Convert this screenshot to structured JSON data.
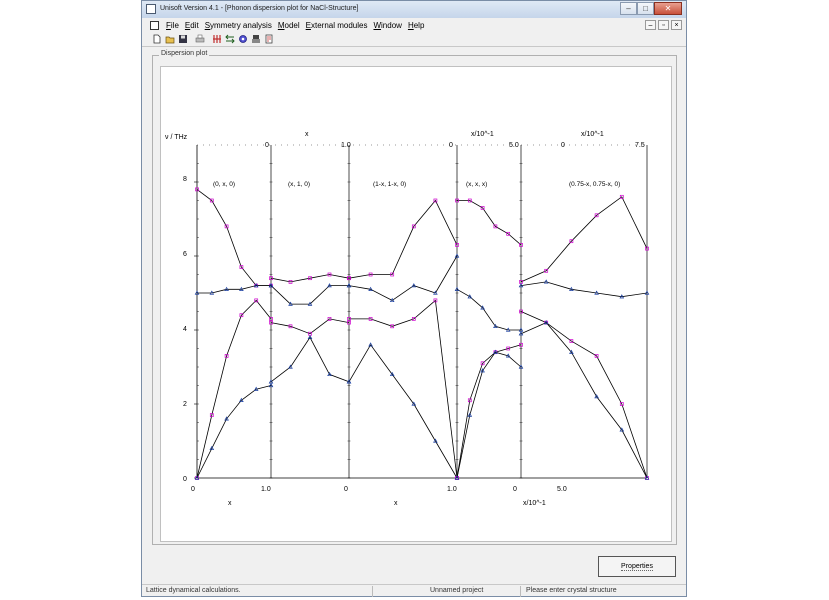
{
  "window": {
    "title": "Unisoft Version 4.1 - [Phonon dispersion plot for NaCl-Structure]"
  },
  "menu": {
    "items": [
      "File",
      "Edit",
      "Symmetry analysis",
      "Model",
      "External modules",
      "Window",
      "Help"
    ]
  },
  "toolbar": {
    "icons": [
      "new-file-icon",
      "open-folder-icon",
      "save-icon",
      "print-icon",
      "tool-a-icon",
      "tool-b-icon",
      "tool-c-icon",
      "tool-d-icon",
      "tool-e-icon"
    ]
  },
  "group": {
    "label": "Dispersion plot"
  },
  "plot": {
    "ylabel": "ν / THz",
    "y_ticks": [
      "0",
      "2",
      "4",
      "6",
      "8"
    ],
    "top_labels": {
      "p1": "x",
      "p1_start": "0",
      "p1_end": "1.0",
      "p3_start": "0",
      "p3_unit": "x/10^-1",
      "p3_end": "5.0",
      "p4_start": "0",
      "p4_unit": "x/10^-1",
      "p4_end": "7.5"
    },
    "bottom_labels": {
      "b0": "0",
      "b1": "1.0",
      "b2": "0",
      "b3": "1.0",
      "b4": "0",
      "b5": "5.0",
      "xl1": "x",
      "xl2": "x",
      "xl3": "x/10^-1"
    },
    "panel_labels": [
      "(0, x, 0)",
      "(x, 1, 0)",
      "(1-x, 1-x, 0)",
      "(x, x, x)",
      "(0.75-x, 0.75-x, 0)"
    ]
  },
  "chart_data": {
    "type": "line",
    "ylabel": "ν / THz",
    "ylim": [
      0,
      9
    ],
    "grid": false,
    "segments": [
      {
        "path": "(0, x, 0)",
        "x": [
          0,
          0.1,
          0.2,
          0.3,
          0.4,
          0.5
        ],
        "series": [
          {
            "values": [
              7.8,
              7.5,
              6.8,
              5.7,
              5.2,
              5.2
            ]
          },
          {
            "values": [
              5.0,
              5.0,
              5.1,
              5.1,
              5.2,
              5.2
            ]
          },
          {
            "values": [
              0,
              1.7,
              3.3,
              4.4,
              4.8,
              4.3
            ]
          },
          {
            "values": [
              0,
              0.8,
              1.6,
              2.1,
              2.4,
              2.5
            ]
          }
        ]
      },
      {
        "path": "(x, 1, 0)",
        "x": [
          0,
          0.25,
          0.5,
          0.75,
          1.0
        ],
        "series": [
          {
            "values": [
              5.4,
              5.3,
              5.4,
              5.5,
              5.4
            ]
          },
          {
            "values": [
              5.2,
              4.7,
              4.7,
              5.2,
              5.2
            ]
          },
          {
            "values": [
              4.2,
              4.1,
              3.9,
              4.3,
              4.2
            ]
          },
          {
            "values": [
              2.6,
              3.0,
              3.8,
              2.8,
              2.6
            ]
          }
        ]
      },
      {
        "path": "(1-x, 1-x, 0)",
        "x": [
          0,
          0.2,
          0.4,
          0.6,
          0.8,
          1.0
        ],
        "series": [
          {
            "values": [
              5.4,
              5.5,
              5.5,
              6.8,
              7.5,
              6.3
            ]
          },
          {
            "values": [
              5.2,
              5.1,
              4.8,
              5.2,
              5.0,
              6.0
            ]
          },
          {
            "values": [
              4.3,
              4.3,
              4.1,
              4.3,
              4.8,
              0
            ]
          },
          {
            "values": [
              2.6,
              3.6,
              2.8,
              2.0,
              1.0,
              0
            ]
          }
        ]
      },
      {
        "path": "(x, x, x)",
        "x": [
          0,
          1.0,
          2.0,
          3.0,
          4.0,
          5.0
        ],
        "series": [
          {
            "values": [
              7.5,
              7.5,
              7.3,
              6.8,
              6.6,
              6.3
            ]
          },
          {
            "values": [
              5.1,
              4.9,
              4.6,
              4.1,
              4.0,
              4.0
            ]
          },
          {
            "values": [
              0,
              2.1,
              3.1,
              3.4,
              3.5,
              3.6
            ]
          },
          {
            "values": [
              0,
              1.7,
              2.9,
              3.4,
              3.3,
              3.0
            ]
          }
        ]
      },
      {
        "path": "(0.75-x, 0.75-x, 0)",
        "x": [
          0,
          1.5,
          3.0,
          4.5,
          6.0,
          7.5
        ],
        "series": [
          {
            "values": [
              5.3,
              5.6,
              6.4,
              7.1,
              7.6,
              6.2
            ]
          },
          {
            "values": [
              5.2,
              5.3,
              5.1,
              5.0,
              4.9,
              5.0
            ]
          },
          {
            "values": [
              4.5,
              4.2,
              3.7,
              3.3,
              2.0,
              0
            ]
          },
          {
            "values": [
              3.9,
              4.2,
              3.4,
              2.2,
              1.3,
              0
            ]
          }
        ]
      }
    ]
  },
  "properties_button": {
    "label": "Properties"
  },
  "status": {
    "left": "Lattice dynamical calculations.",
    "middle": "Unnamed project",
    "right": "Please enter crystal structure"
  },
  "colors": {
    "series_a": "#cc00cc",
    "series_b": "#1a3fa0",
    "line": "#000000"
  }
}
